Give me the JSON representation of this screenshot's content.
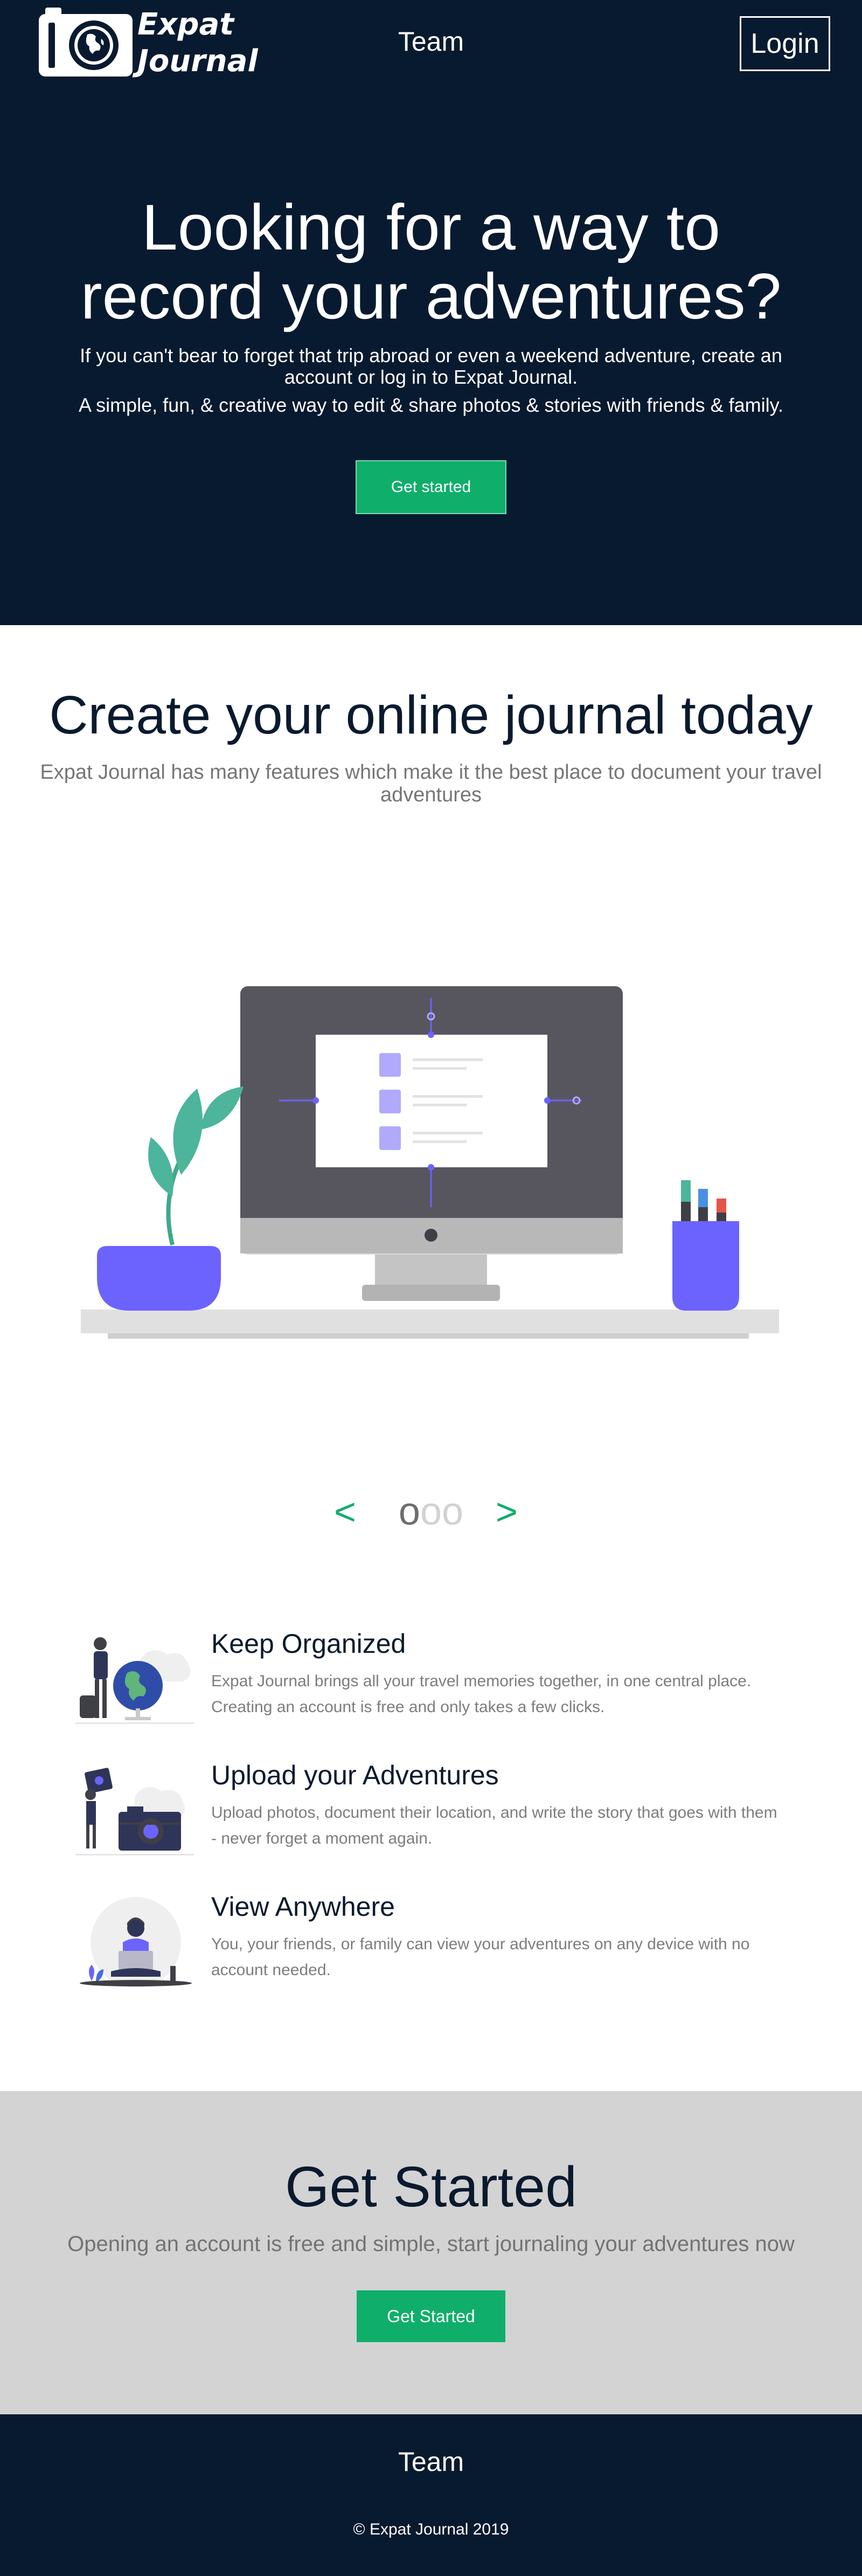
{
  "brand": {
    "name_line1": "Expat",
    "name_line2": "Journal",
    "logo_icon": "camera-globe-icon"
  },
  "nav": {
    "team_label": "Team",
    "login_label": "Login"
  },
  "hero": {
    "title": "Looking for a way to record your adventures?",
    "paragraph1": "If you can't bear to forget that trip abroad or even a weekend adventure, create an account or log in to Expat Journal.",
    "paragraph2": "A simple, fun, & creative way to edit & share photos & stories with friends & family.",
    "cta_label": "Get started"
  },
  "features_intro": {
    "title": "Create your online journal today",
    "subtitle": "Expat Journal has many features which make it the best place to document your travel adventures"
  },
  "carousel": {
    "prev_label": "<",
    "next_label": ">",
    "dots": [
      "o",
      "o",
      "o"
    ],
    "active_index": 0
  },
  "features": [
    {
      "title": "Keep Organized",
      "text": "Expat Journal brings all your travel memories together, in one central place. Creating an account is free and only takes a few clicks.",
      "icon": "traveler-globe-illustration"
    },
    {
      "title": "Upload your Adventures",
      "text": "Upload photos, document their location, and write the story that goes with them - never forget a moment again.",
      "icon": "camera-upload-illustration"
    },
    {
      "title": "View Anywhere",
      "text": "You, your friends, or family can view your adventures on any device with no account needed.",
      "icon": "laptop-person-illustration"
    }
  ],
  "get_started": {
    "title": "Get Started",
    "subtitle": "Opening an account is free and simple, start journaling your adventures now",
    "button_label": "Get Started"
  },
  "footer": {
    "team_label": "Team",
    "copyright": "© Expat Journal 2019"
  },
  "colors": {
    "navy": "#081a30",
    "accent_green": "#0fae6b",
    "illustration_purple": "#6c63ff",
    "cta_gray": "#d3d3d3"
  }
}
